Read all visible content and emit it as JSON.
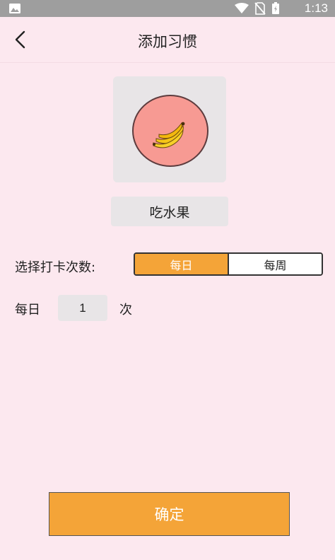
{
  "status_bar": {
    "time": "1:13",
    "icons": [
      "gallery-icon",
      "wifi-icon",
      "no-sim-icon",
      "battery-icon"
    ]
  },
  "app_bar": {
    "title": "添加习惯",
    "back_icon": "chevron-left-icon"
  },
  "habit": {
    "icon": "banana-icon",
    "icon_bg_color": "#f79a93",
    "name": "吃水果"
  },
  "frequency": {
    "label": "选择打卡次数:",
    "options": [
      "每日",
      "每周"
    ],
    "selected": "每日",
    "accent_color": "#f4a438"
  },
  "count": {
    "prefix": "每日",
    "value": "1",
    "suffix": "次"
  },
  "confirm_label": "确定"
}
